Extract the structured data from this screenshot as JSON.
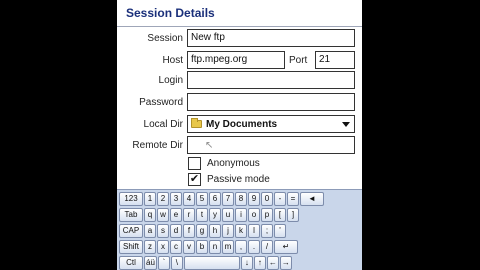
{
  "title": "Session Details",
  "form": {
    "session_label": "Session",
    "session_value": "New ftp",
    "host_label": "Host",
    "host_value": "ftp.mpeg.org",
    "port_label": "Port",
    "port_value": "21",
    "login_label": "Login",
    "login_value": "",
    "password_label": "Password",
    "password_value": "",
    "localdir_label": "Local Dir",
    "localdir_value": "My Documents",
    "remotedir_label": "Remote Dir",
    "remotedir_value": "",
    "anonymous_label": "Anonymous",
    "anonymous_checked": false,
    "passive_label": "Passive mode",
    "passive_checked": true
  },
  "keyboard": {
    "rows": [
      [
        "123",
        "1",
        "2",
        "3",
        "4",
        "5",
        "6",
        "7",
        "8",
        "9",
        "0",
        "-",
        "=",
        "◄"
      ],
      [
        "Tab",
        "q",
        "w",
        "e",
        "r",
        "t",
        "y",
        "u",
        "i",
        "o",
        "p",
        "[",
        "]"
      ],
      [
        "CAP",
        "a",
        "s",
        "d",
        "f",
        "g",
        "h",
        "j",
        "k",
        "l",
        ";",
        "'"
      ],
      [
        "Shift",
        "z",
        "x",
        "c",
        "v",
        "b",
        "n",
        "m",
        ",",
        ".",
        "/",
        "↵"
      ],
      [
        "Ctl",
        "áü",
        "`",
        "\\",
        " ",
        "↓",
        "↑",
        "←",
        "→"
      ]
    ]
  },
  "icons": {
    "folder": "folder-icon",
    "dropdown": "chevron-down-icon",
    "check": "✔"
  }
}
